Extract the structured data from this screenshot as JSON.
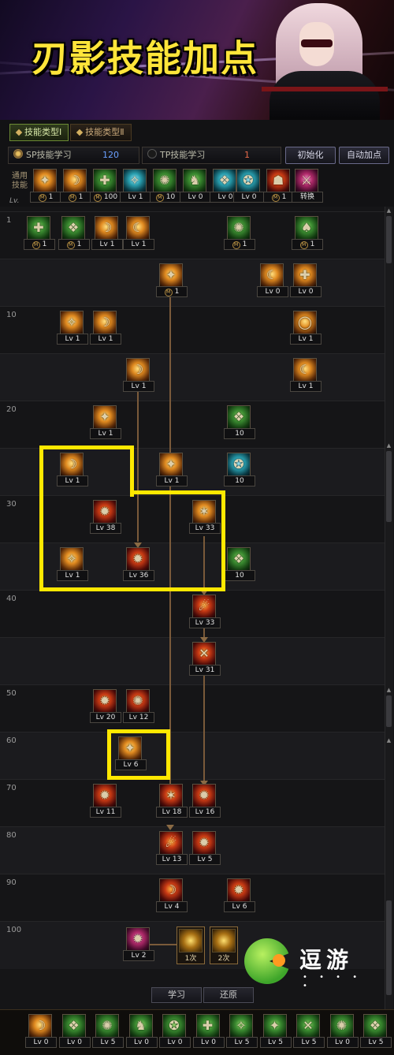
{
  "banner": {
    "title": "刃影技能加点"
  },
  "tabs": [
    {
      "label": "技能类型Ⅰ"
    },
    {
      "label": "技能类型Ⅱ"
    }
  ],
  "points": {
    "sp": {
      "label": "SP技能学习",
      "value": "120"
    },
    "tp": {
      "label": "TP技能学习",
      "value": "1"
    }
  },
  "buttons": {
    "init": "初始化",
    "auto": "自动加点",
    "learn": "学习",
    "revert": "还原"
  },
  "common": {
    "label": "通用技能",
    "lv_label": "Lv.",
    "skills": [
      "1",
      "1",
      "100",
      "Lv 1",
      "10",
      "Lv 0",
      "Lv 0",
      "Lv 0",
      "1",
      "转换"
    ]
  },
  "levels": [
    "1",
    "10",
    "20",
    "30",
    "40",
    "50",
    "60",
    "70",
    "80",
    "90",
    "100"
  ],
  "tree_skills": [
    {
      "cap": "1",
      "m": true
    },
    {
      "cap": "1",
      "m": true
    },
    {
      "cap": "Lv 1"
    },
    {
      "cap": "Lv 1"
    },
    {
      "cap": "1",
      "m": true
    },
    {
      "cap": "1",
      "m": true
    },
    {
      "cap": "1",
      "m": true
    },
    {
      "cap": "Lv 0"
    },
    {
      "cap": "Lv 0"
    },
    {
      "cap": "Lv 1"
    },
    {
      "cap": "Lv 1"
    },
    {
      "cap": "Lv 1"
    },
    {
      "cap": "Lv 1"
    },
    {
      "cap": "Lv 1"
    },
    {
      "cap": "Lv 1"
    },
    {
      "cap": "10"
    },
    {
      "cap": "Lv 1"
    },
    {
      "cap": "Lv 1"
    },
    {
      "cap": "10"
    },
    {
      "cap": "Lv 38"
    },
    {
      "cap": "Lv 33"
    },
    {
      "cap": "Lv 1"
    },
    {
      "cap": "Lv 36"
    },
    {
      "cap": "10"
    },
    {
      "cap": "Lv 33"
    },
    {
      "cap": "Lv 31"
    },
    {
      "cap": "Lv 20"
    },
    {
      "cap": "Lv 12"
    },
    {
      "cap": "Lv 6"
    },
    {
      "cap": "Lv 11"
    },
    {
      "cap": "Lv 18"
    },
    {
      "cap": "Lv 16"
    },
    {
      "cap": "Lv 13"
    },
    {
      "cap": "Lv 5"
    },
    {
      "cap": "Lv 4"
    },
    {
      "cap": "Lv 6"
    },
    {
      "cap": "Lv 2"
    }
  ],
  "awakening": [
    {
      "label": "1次"
    },
    {
      "label": "2次"
    }
  ],
  "quickbar": [
    "Lv 0",
    "Lv 0",
    "Lv 5",
    "Lv 0",
    "Lv 0",
    "Lv 0",
    "Lv 5",
    "Lv 5",
    "Lv 5",
    "Lv 0",
    "Lv 5"
  ],
  "watermark": {
    "text": "逗游",
    "dots": "• • • • •"
  }
}
